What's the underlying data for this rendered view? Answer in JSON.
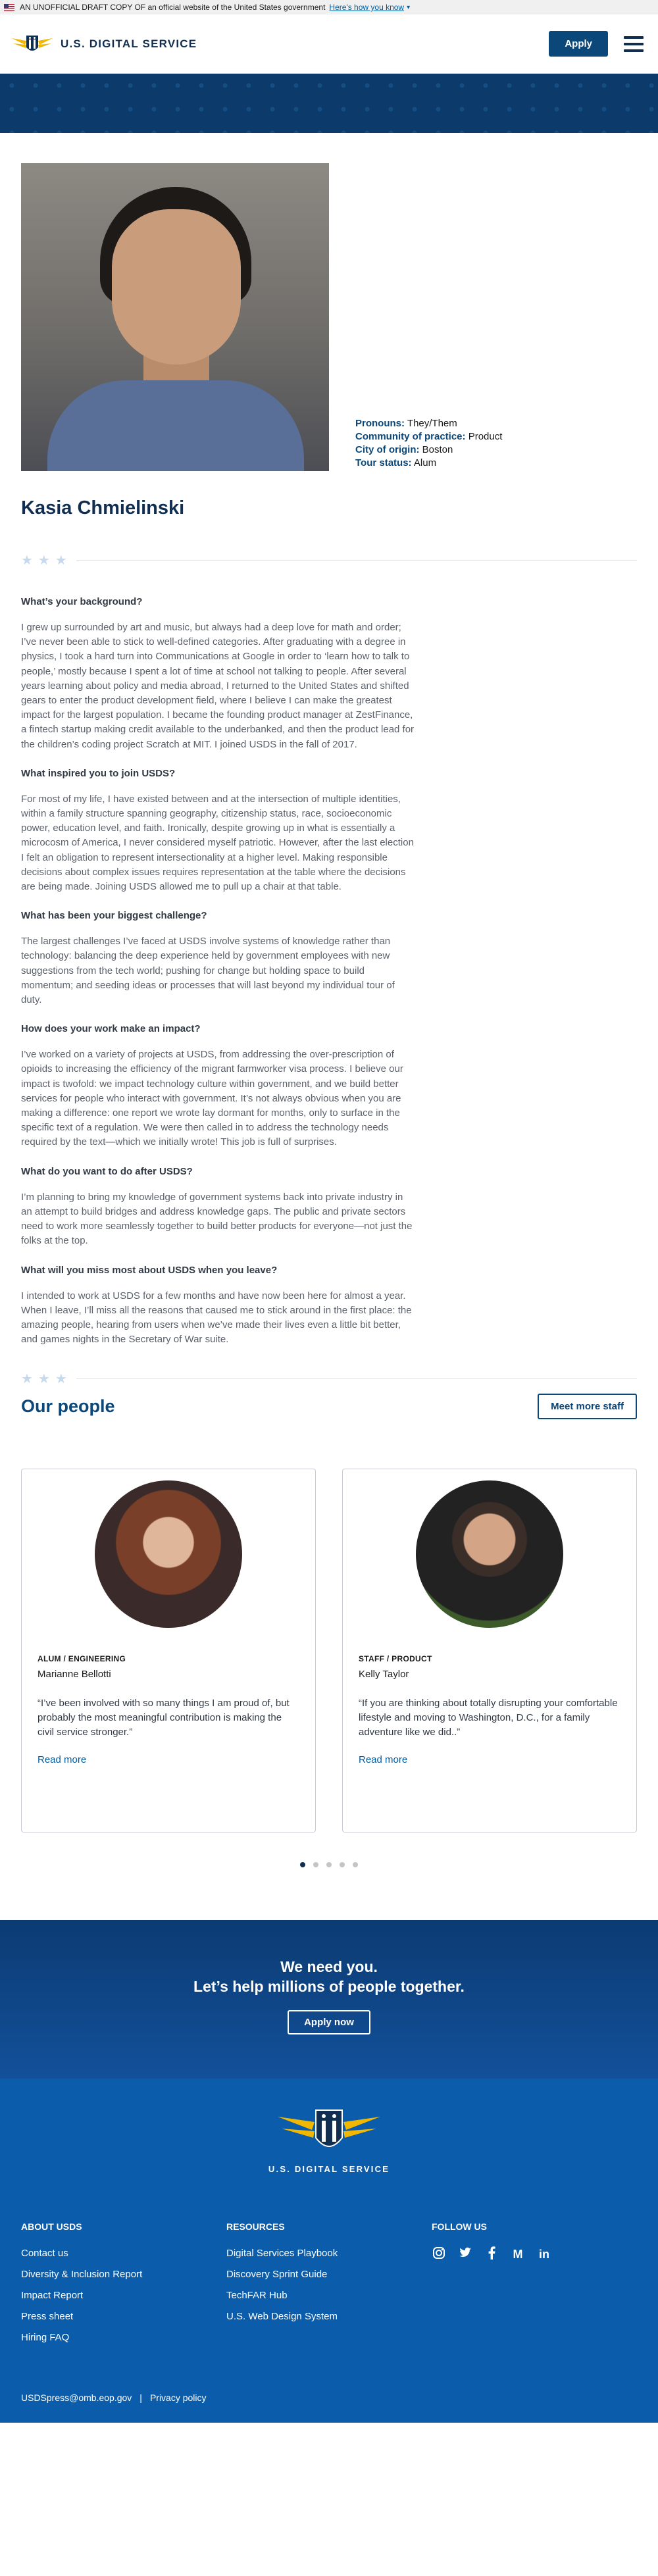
{
  "gov_banner": {
    "text": "AN UNOFFICIAL DRAFT COPY OF an official website of the United States government",
    "link": "Here's how you know"
  },
  "header": {
    "logo_text": "U.S. DIGITAL SERVICE",
    "apply_label": "Apply"
  },
  "profile": {
    "facts": [
      {
        "key": "Pronouns:",
        "value": "They/Them"
      },
      {
        "key": "Community of practice:",
        "value": "Product"
      },
      {
        "key": "City of origin:",
        "value": "Boston"
      },
      {
        "key": "Tour status:",
        "value": "Alum"
      }
    ],
    "name": "Kasia Chmielinski",
    "qa": [
      {
        "q": "What’s your background?",
        "a": "I grew up surrounded by art and music, but always had a deep love for math and order; I’ve never been able to stick to well-defined categories. After graduating with a degree in physics, I took a hard turn into Communications at Google in order to ‘learn how to talk to people,’ mostly because I spent a lot of time at school not talking to people. After several years learning about policy and media abroad, I returned to the United States and shifted gears to enter the product development field, where I believe I can make the greatest impact for the largest population. I became the founding product manager at ZestFinance, a fintech startup making credit available to the underbanked, and then the product lead for the children’s coding project Scratch at MIT. I joined USDS in the fall of 2017."
      },
      {
        "q": "What inspired you to join USDS?",
        "a": "For most of my life, I have existed between and at the intersection of multiple identities, within a family structure spanning geography, citizenship status, race, socioeconomic power, education level, and faith. Ironically, despite growing up in what is essentially a microcosm of America, I never considered myself patriotic. However, after the last election I felt an obligation to represent intersectionality at a higher level. Making responsible decisions about complex issues requires representation at the table where the decisions are being made. Joining USDS allowed me to pull up a chair at that table."
      },
      {
        "q": "What has been your biggest challenge?",
        "a": "The largest challenges I’ve faced at USDS involve systems of knowledge rather than technology: balancing the deep experience held by government employees with new suggestions from the tech world; pushing for change but holding space to build momentum; and seeding ideas or processes that will last beyond my individual tour of duty."
      },
      {
        "q": "How does your work make an impact?",
        "a": "I’ve worked on a variety of projects at USDS, from addressing the over-prescription of opioids to increasing the efficiency of the migrant farmworker visa process. I believe our impact is twofold: we impact technology culture within government, and we build better services for people who interact with government. It’s not always obvious when you are making a difference: one report we wrote lay dormant for months, only to surface in the specific text of a regulation. We were then called in to address the technology needs required by the text—which we initially wrote! This job is full of surprises."
      },
      {
        "q": "What do you want to do after USDS?",
        "a": "I’m planning to bring my knowledge of government systems back into private industry in an attempt to build bridges and address knowledge gaps. The public and private sectors need to work more seamlessly together to build better products for everyone—not just the folks at the top."
      },
      {
        "q": "What will you miss most about USDS when you leave?",
        "a": "I intended to work at USDS for a few months and have now been here for almost a year. When I leave, I’ll miss all the reasons that caused me to stick around in the first place: the amazing people, hearing from users when we’ve made their lives even a little bit better, and games nights in the Secretary of War suite."
      }
    ]
  },
  "people": {
    "title": "Our people",
    "more_label": "Meet more staff",
    "cards": [
      {
        "role": "ALUM / ENGINEERING",
        "name": "Marianne Bellotti",
        "quote": "“I’ve been involved with so many things I am proud of, but probably the most meaningful contribution is making the civil service stronger.”",
        "read_more": "Read more"
      },
      {
        "role": "STAFF / PRODUCT",
        "name": "Kelly Taylor",
        "quote": "“If you are thinking about totally disrupting your comfortable lifestyle and moving to Washington, D.C., for a family adventure like we did..”",
        "read_more": "Read more"
      }
    ],
    "pagination_count": 5,
    "active_page": 1
  },
  "cta": {
    "line1": "We need you.",
    "line2": "Let’s help millions of people together.",
    "button": "Apply now"
  },
  "footer": {
    "logo_text": "U.S. DIGITAL SERVICE",
    "about": {
      "title": "ABOUT USDS",
      "links": [
        "Contact us",
        "Diversity & Inclusion Report",
        "Impact Report",
        "Press sheet",
        "Hiring FAQ"
      ]
    },
    "resources": {
      "title": "RESOURCES",
      "links": [
        "Digital Services Playbook",
        "Discovery Sprint Guide",
        "TechFAR Hub",
        "U.S. Web Design System"
      ]
    },
    "follow": {
      "title": "FOLLOW US",
      "icons": [
        "instagram-icon",
        "twitter-icon",
        "facebook-icon",
        "medium-icon",
        "linkedin-icon"
      ]
    },
    "email": "USDSpress@omb.eop.gov",
    "separator": "|",
    "privacy": "Privacy policy"
  },
  "colors": {
    "brand_navy": "#112e51",
    "brand_blue": "#0b4778",
    "footer_blue": "#0b5dab",
    "link": "#005ea2"
  }
}
